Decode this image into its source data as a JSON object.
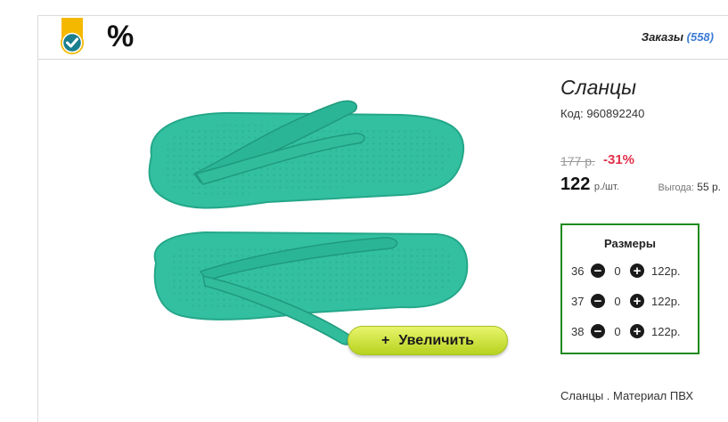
{
  "header": {
    "badge_icon": "check-badge-icon",
    "percent_label": "%",
    "orders_label": "Заказы",
    "orders_count": "(558)"
  },
  "product": {
    "title": "Сланцы",
    "code": "Код: 960892240",
    "old_price": "177 р.",
    "discount": "-31%",
    "price": "122",
    "price_unit": "р./шт.",
    "savings_label": "Выгода:",
    "savings_value": "55 р.",
    "zoom_button": "Увеличить",
    "zoom_plus": "+",
    "description": "Сланцы . Материал ПВХ",
    "image_icon": "flip-flops-image",
    "accent_color": "#2bb597"
  },
  "sizes": {
    "title": "Размеры",
    "rows": [
      {
        "size": "36",
        "qty": "0",
        "price": "122р."
      },
      {
        "size": "37",
        "qty": "0",
        "price": "122р."
      },
      {
        "size": "38",
        "qty": "0",
        "price": "122р."
      }
    ],
    "minus_icon": "minus-circle-icon",
    "plus_icon": "plus-circle-icon"
  }
}
